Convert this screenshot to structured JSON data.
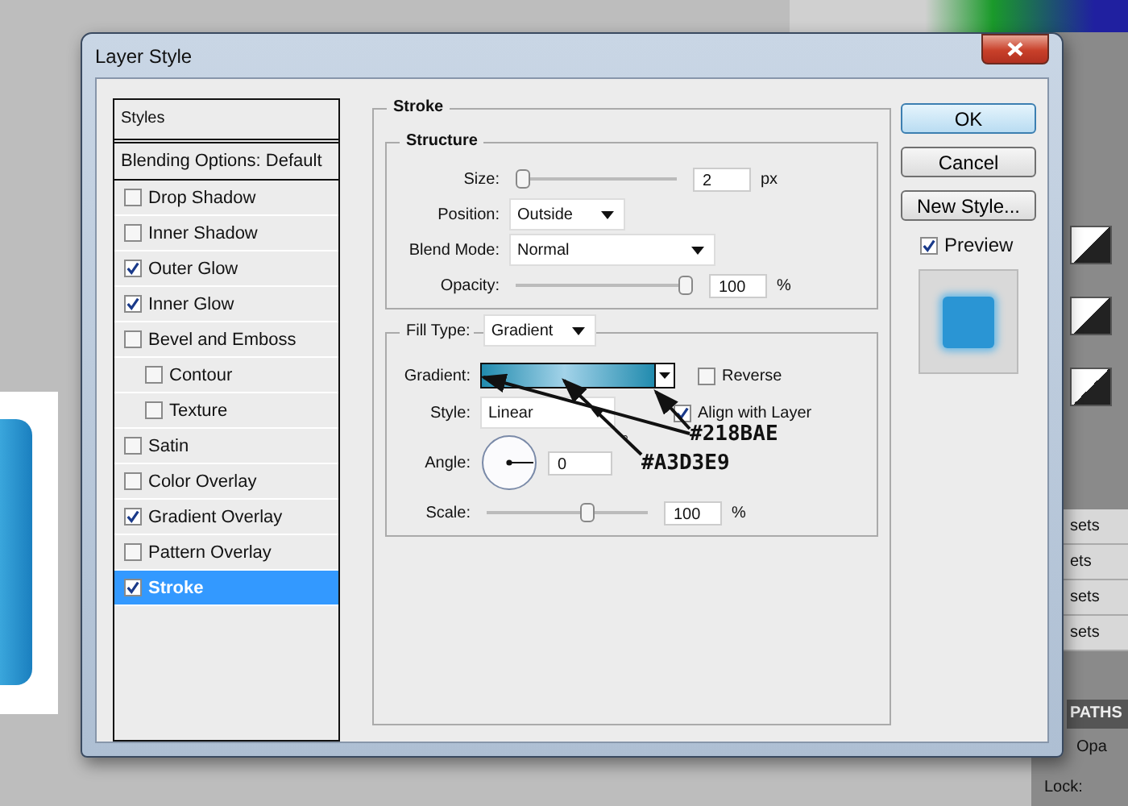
{
  "window": {
    "title": "Layer Style"
  },
  "styles_list": {
    "header": "Styles",
    "items": [
      {
        "label": "Blending Options: Default",
        "kind": "plain",
        "selected": false
      },
      {
        "label": "Drop Shadow",
        "kind": "effect",
        "checked": false,
        "selected": false
      },
      {
        "label": "Inner Shadow",
        "kind": "effect",
        "checked": false,
        "selected": false
      },
      {
        "label": "Outer Glow",
        "kind": "effect",
        "checked": true,
        "selected": false
      },
      {
        "label": "Inner Glow",
        "kind": "effect",
        "checked": true,
        "selected": false
      },
      {
        "label": "Bevel and Emboss",
        "kind": "effect",
        "checked": false,
        "selected": false
      },
      {
        "label": "Contour",
        "kind": "subeffect",
        "checked": false,
        "selected": false
      },
      {
        "label": "Texture",
        "kind": "subeffect",
        "checked": false,
        "selected": false
      },
      {
        "label": "Satin",
        "kind": "effect",
        "checked": false,
        "selected": false
      },
      {
        "label": "Color Overlay",
        "kind": "effect",
        "checked": false,
        "selected": false
      },
      {
        "label": "Gradient Overlay",
        "kind": "effect",
        "checked": true,
        "selected": false
      },
      {
        "label": "Pattern Overlay",
        "kind": "effect",
        "checked": false,
        "selected": false
      },
      {
        "label": "Stroke",
        "kind": "effect",
        "checked": true,
        "selected": true
      }
    ]
  },
  "stroke": {
    "title": "Stroke",
    "structure": {
      "title": "Structure",
      "size": {
        "label": "Size:",
        "level": 0,
        "value": "2",
        "unit": "px"
      },
      "position": {
        "label": "Position:",
        "value": "Outside"
      },
      "blend_mode": {
        "label": "Blend Mode:",
        "value": "Normal"
      },
      "opacity": {
        "label": "Opacity:",
        "level": 1,
        "value": "100",
        "unit": "%"
      }
    },
    "fill": {
      "label": "Fill Type:",
      "value": "Gradient",
      "gradient": {
        "label": "Gradient:"
      },
      "reverse": {
        "label": "Reverse",
        "checked": false
      },
      "style": {
        "label": "Style:",
        "value": "Linear"
      },
      "align": {
        "label": "Align with Layer",
        "checked": true
      },
      "angle": {
        "label": "Angle:",
        "value": "0",
        "unit": "°"
      },
      "scale": {
        "label": "Scale:",
        "level": 0.64,
        "value": "100",
        "unit": "%"
      }
    }
  },
  "buttons": [
    {
      "label": "OK",
      "default": true
    },
    {
      "label": "Cancel",
      "default": false
    },
    {
      "label": "New Style...",
      "default": false
    }
  ],
  "preview": {
    "label": "Preview",
    "checked": true
  },
  "annotations": [
    {
      "text": "#218BAE"
    },
    {
      "text": "#A3D3E9"
    }
  ],
  "background_panel": {
    "rows": [
      "sets",
      "ets",
      "sets",
      "sets"
    ],
    "tab": "PATHS",
    "opacity_label": "Opa",
    "lock_label": "Lock:"
  }
}
